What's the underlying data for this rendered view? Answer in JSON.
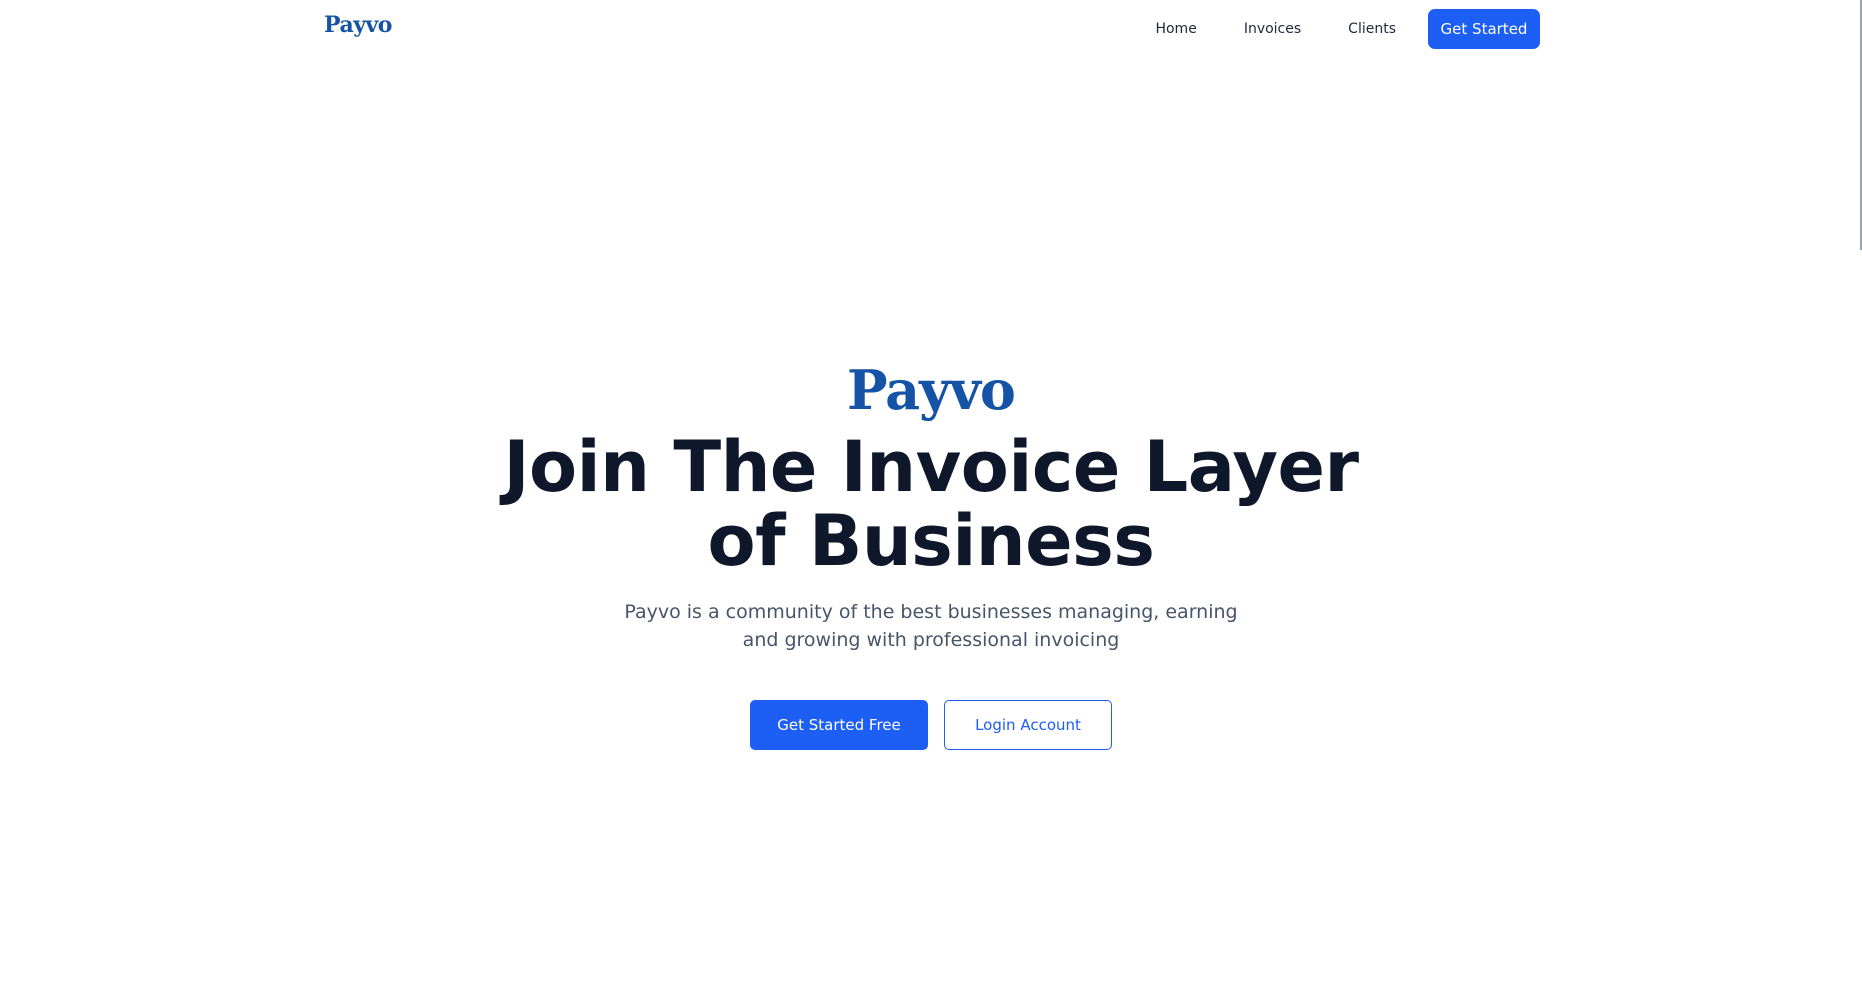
{
  "nav": {
    "logo": "Payvo",
    "links": [
      "Home",
      "Invoices",
      "Clients"
    ],
    "cta_label": "Get Started"
  },
  "hero": {
    "logo": "Payvo",
    "title": "Join The Invoice Layer of Business",
    "subtitle": "Payvo is a community of the best businesses managing, earning and growing with professional invoicing",
    "primary_label": "Get Started Free",
    "secondary_label": "Login Account"
  },
  "colors": {
    "brand": "#1553a6",
    "accent": "#1d5ef5",
    "heading": "#0f172a",
    "body_text": "#475569"
  }
}
